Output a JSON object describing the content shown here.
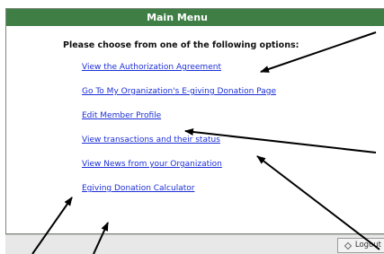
{
  "header": {
    "title": "Main Menu"
  },
  "prompt": "Please choose from one of the following options:",
  "menu": {
    "items": [
      {
        "label": "View the Authorization Agreement"
      },
      {
        "label": "Go To My Organization's E-giving Donation Page"
      },
      {
        "label": "Edit Member Profile"
      },
      {
        "label": "View transactions and their status"
      },
      {
        "label": "View News from your Organization"
      },
      {
        "label": "Egiving Donation Calculator"
      }
    ]
  },
  "footer": {
    "logout_label": "Logout"
  },
  "colors": {
    "title_bar": "#3f7f46",
    "link": "#1c2fd6",
    "footer": "#e8e8e8"
  }
}
